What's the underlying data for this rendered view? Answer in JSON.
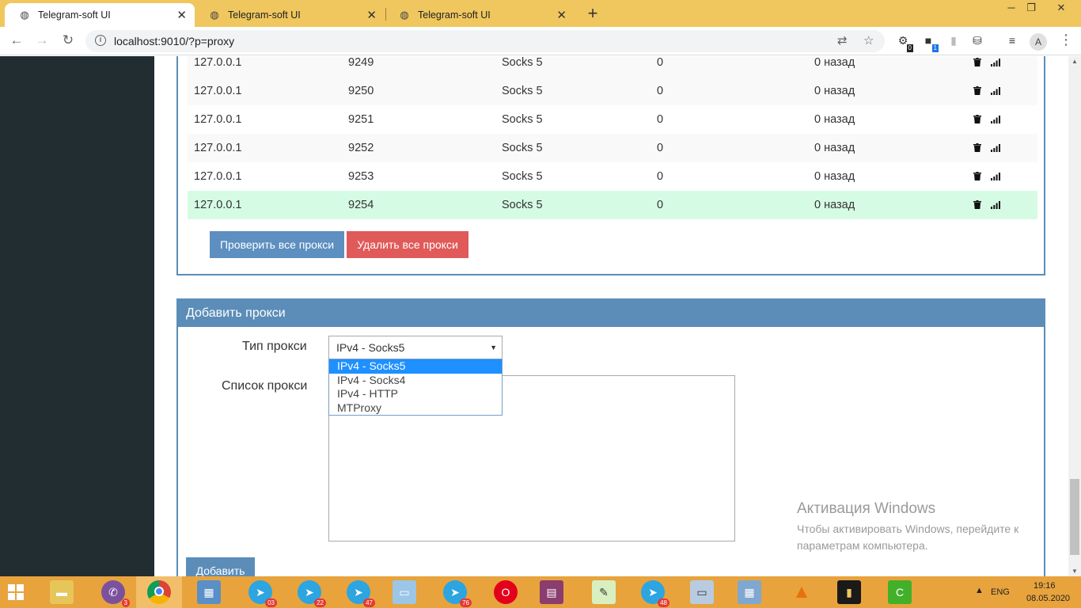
{
  "browser": {
    "tabs": [
      {
        "title": "Telegram-soft UI",
        "active": true
      },
      {
        "title": "Telegram-soft UI",
        "active": false
      },
      {
        "title": "Telegram-soft UI",
        "active": false
      }
    ],
    "url": "localhost:9010/?p=proxy",
    "profile_initial": "A",
    "ext_badges": [
      "0",
      "1"
    ]
  },
  "proxy_table": {
    "rows": [
      {
        "ip": "127.0.0.1",
        "port": "9249",
        "type": "Socks 5",
        "count": "0",
        "checked": "0 назад"
      },
      {
        "ip": "127.0.0.1",
        "port": "9250",
        "type": "Socks 5",
        "count": "0",
        "checked": "0 назад"
      },
      {
        "ip": "127.0.0.1",
        "port": "9251",
        "type": "Socks 5",
        "count": "0",
        "checked": "0 назад"
      },
      {
        "ip": "127.0.0.1",
        "port": "9252",
        "type": "Socks 5",
        "count": "0",
        "checked": "0 назад"
      },
      {
        "ip": "127.0.0.1",
        "port": "9253",
        "type": "Socks 5",
        "count": "0",
        "checked": "0 назад"
      },
      {
        "ip": "127.0.0.1",
        "port": "9254",
        "type": "Socks 5",
        "count": "0",
        "checked": "0 назад"
      }
    ],
    "check_all_label": "Проверить все прокси",
    "delete_all_label": "Удалить все прокси"
  },
  "add_proxy": {
    "title": "Добавить прокси",
    "type_label": "Тип прокси",
    "type_value": "IPv4 - Socks5",
    "type_options": [
      "IPv4 - Socks5",
      "IPv4 - Socks4",
      "IPv4 - HTTP",
      "MTProxy"
    ],
    "list_label": "Список прокси",
    "add_label": "Добавить"
  },
  "watermark": {
    "title": "Активация Windows",
    "line1": "Чтобы активировать Windows, перейдите к",
    "line2": "параметрам компьютера."
  },
  "taskbar": {
    "badges": {
      "viber": "3",
      "tg1": "03",
      "tg2": "22",
      "tg3": "47",
      "tg4": "76",
      "tg5": "48"
    },
    "lang": "ENG",
    "time": "19:16",
    "date": "08.05.2020"
  },
  "colors": {
    "tabbar": "#f0c75e",
    "sidebar": "#222d32",
    "panel_accent": "#5b8db8",
    "danger": "#e05a5a",
    "row_highlight": "#d6fbe4",
    "taskbar": "#e8a33c"
  }
}
